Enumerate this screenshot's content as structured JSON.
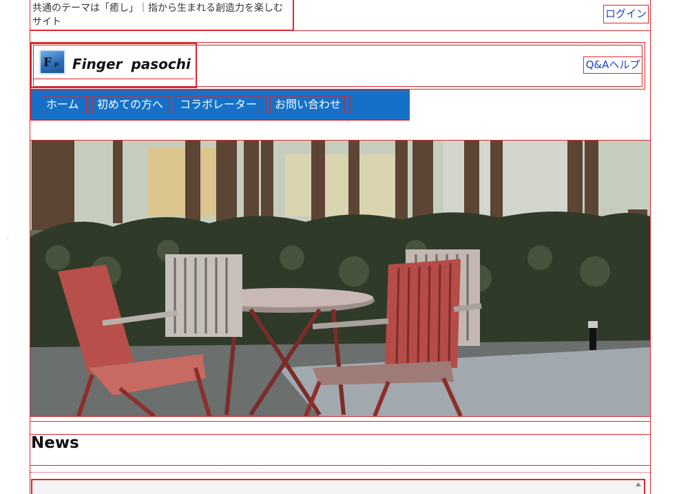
{
  "top": {
    "tagline": "共通のテーマは「癒し」｜指から生まれる創造力を楽しむサイト",
    "login_label": "ログイン"
  },
  "header": {
    "logo_text": "Finger  pasochi",
    "logo_mark": "F",
    "logo_mark_sub": "P",
    "help_label": "Q&Aヘルプ"
  },
  "nav": {
    "items": [
      {
        "label": "ホーム"
      },
      {
        "label": "初めての方へ"
      },
      {
        "label": "コラボレーター"
      },
      {
        "label": "お問い合わせ"
      }
    ]
  },
  "news": {
    "title": "News"
  },
  "colors": {
    "nav_bg": "#1571c8",
    "link": "#1a3fd0",
    "outline": "#d9262b"
  }
}
